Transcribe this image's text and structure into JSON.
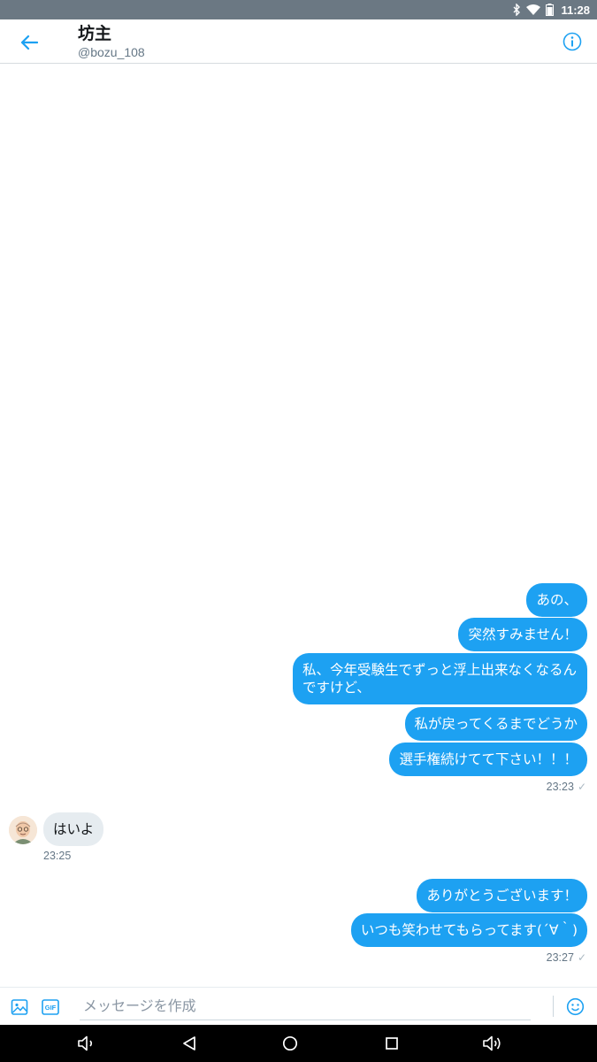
{
  "status_bar": {
    "time": "11:28",
    "icons": [
      "bluetooth-icon",
      "wifi-icon",
      "battery-icon"
    ]
  },
  "header": {
    "title": "坊主",
    "handle": "@bozu_108",
    "back_icon": "back-arrow-icon",
    "info_icon": "info-icon"
  },
  "colors": {
    "accent": "#1da1f2",
    "incoming_bubble": "#e6ecf0",
    "status_bar": "#6b7883",
    "nav_bar": "#000000"
  },
  "messages": [
    {
      "direction": "out",
      "text": "あの、"
    },
    {
      "direction": "out",
      "text": "突然すみません！"
    },
    {
      "direction": "out",
      "text": "私、今年受験生でずっと浮上出来なくなるんですけど、"
    },
    {
      "direction": "out",
      "text": "私が戻ってくるまでどうか"
    },
    {
      "direction": "out",
      "text": "選手権続けてて下さい！！！"
    },
    {
      "direction": "out",
      "time": "23:23",
      "status": "✓"
    },
    {
      "direction": "in",
      "text": "はいよ",
      "time": "23:25"
    },
    {
      "direction": "out",
      "text": "ありがとうございます！"
    },
    {
      "direction": "out",
      "text": "いつも笑わせてもらってます(´∀｀)"
    },
    {
      "direction": "out",
      "time": "23:27",
      "status": "✓"
    }
  ],
  "composer": {
    "placeholder": "メッセージを作成",
    "gif_label": "GIF",
    "media_icon": "image-icon",
    "emoji_icon": "emoji-icon"
  },
  "nav_bar": {
    "icons": [
      "volume-down-icon",
      "back-triangle-icon",
      "home-circle-icon",
      "recents-square-icon",
      "volume-up-icon"
    ]
  }
}
